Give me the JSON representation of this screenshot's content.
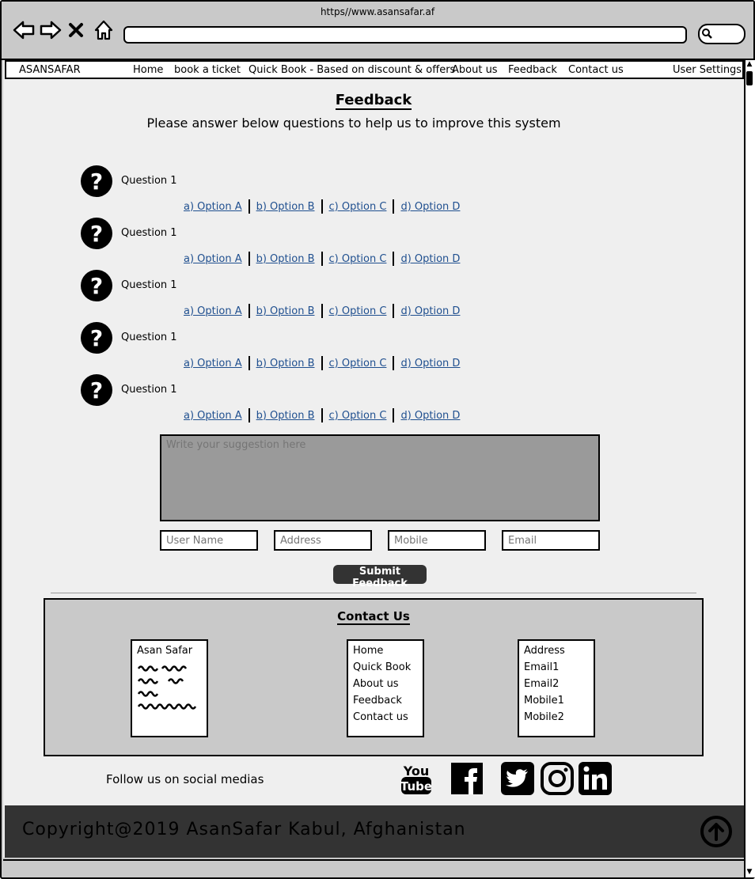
{
  "browser": {
    "url": "https//www.asansafar.af"
  },
  "menu": {
    "brand": "ASANSAFAR",
    "items": [
      "Home",
      "book a ticket",
      "Quick Book - Based on discount & offers",
      "About us",
      "Feedback",
      "Contact us"
    ],
    "settings": "User Settings"
  },
  "page": {
    "title": "Feedback",
    "subtitle": "Please answer below questions to help us to improve this system"
  },
  "questions": [
    {
      "label": "Question 1",
      "options": [
        "a) Option A",
        "b) Option B",
        "c) Option C",
        "d) Option D"
      ]
    },
    {
      "label": "Question 1",
      "options": [
        "a) Option A",
        "b) Option B",
        "c) Option C",
        "d) Option D"
      ]
    },
    {
      "label": "Question 1",
      "options": [
        "a) Option A",
        "b) Option B",
        "c) Option C",
        "d) Option D"
      ]
    },
    {
      "label": "Question 1",
      "options": [
        "a) Option A",
        "b) Option B",
        "c) Option C",
        "d) Option D"
      ]
    },
    {
      "label": "Question 1",
      "options": [
        "a) Option A",
        "b) Option B",
        "c) Option C",
        "d) Option D"
      ]
    }
  ],
  "form": {
    "suggestion_placeholder": "Write your suggestion here",
    "username_placeholder": "User Name",
    "address_placeholder": "Address",
    "mobile_placeholder": "Mobile",
    "email_placeholder": "Email",
    "submit_label": "Submit Feedback"
  },
  "contact": {
    "title": "Contact Us",
    "company": "Asan Safar",
    "links": [
      "Home",
      "Quick Book",
      "About us",
      "Feedback",
      "Contact us"
    ],
    "details": [
      "Address",
      "Email1",
      "Email2",
      "Mobile1",
      "Mobile2"
    ]
  },
  "social": {
    "label": "Follow us on social medias",
    "icons": [
      "youtube-icon",
      "facebook-icon",
      "twitter-icon",
      "instagram-icon",
      "linkedin-icon"
    ]
  },
  "footer": {
    "copyright": "Copyright@2019 AsanSafar Kabul, Afghanistan"
  },
  "colors": {
    "link": "#1f4f8f",
    "footer_bg": "#333333",
    "page_bg": "#efefef",
    "chrome_bg": "#c9c9c9"
  }
}
